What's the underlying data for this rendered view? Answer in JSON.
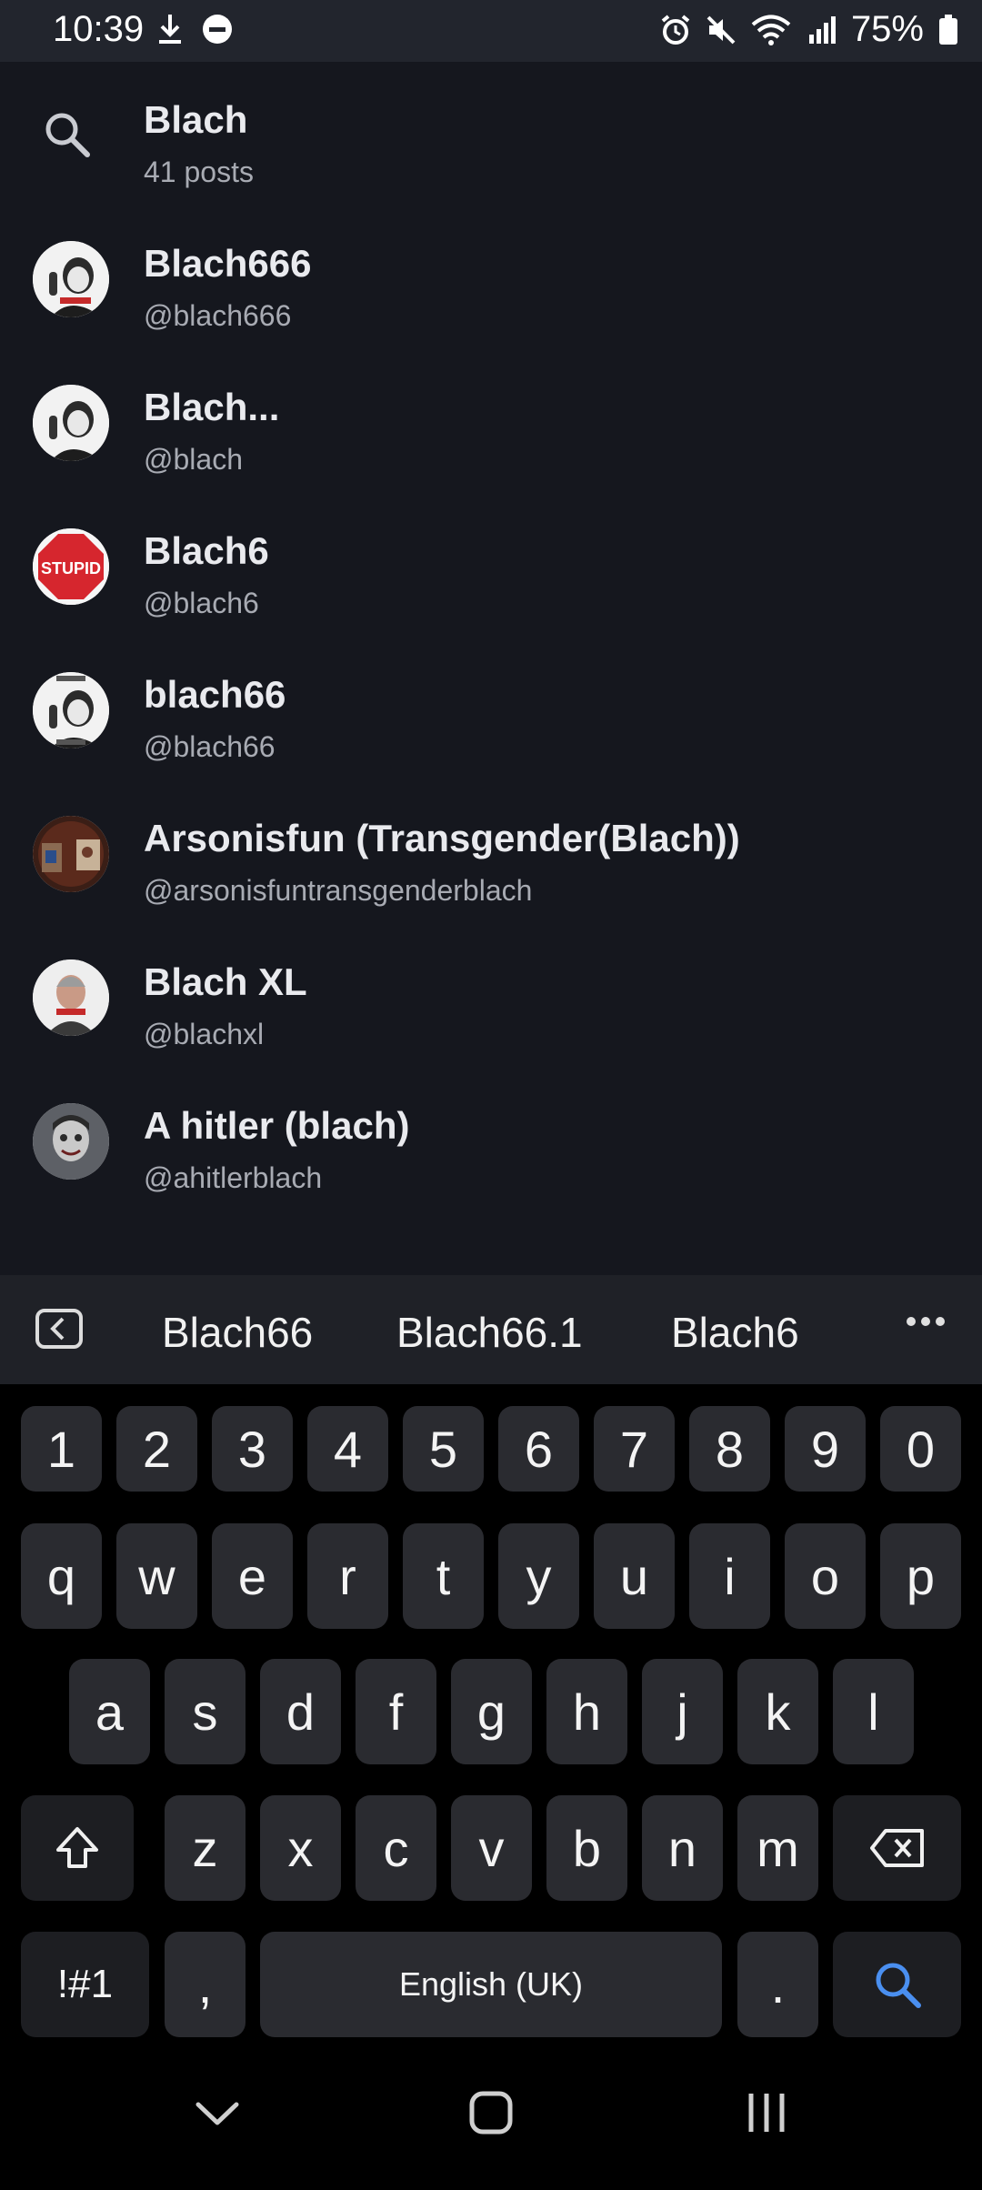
{
  "status_bar": {
    "time": "10:39",
    "battery_percent": "75%",
    "icons": [
      "download-icon",
      "dnd-icon",
      "alarm-icon",
      "mute-icon",
      "wifi-icon",
      "signal-icon",
      "battery-icon"
    ]
  },
  "search_suggestion": {
    "query": "Blach",
    "count_label": "41 posts"
  },
  "users": [
    {
      "name": "Blach666",
      "handle": "@blach666",
      "avatar": "meme-avatar"
    },
    {
      "name": "Blach...",
      "handle": "@blach",
      "avatar": "meme-avatar"
    },
    {
      "name": "Blach6",
      "handle": "@blach6",
      "avatar": "stupid-sign-avatar",
      "avatar_text": "STUPID"
    },
    {
      "name": "blach66",
      "handle": "@blach66",
      "avatar": "meme-avatar"
    },
    {
      "name": "Arsonisfun (Transgender(Blach))",
      "handle": "@arsonisfuntransgenderblach",
      "avatar": "photo-avatar"
    },
    {
      "name": "Blach XL",
      "handle": "@blachxl",
      "avatar": "photo-avatar"
    },
    {
      "name": "A hitler (blach)",
      "handle": "@ahitlerblach",
      "avatar": "photo-avatar"
    }
  ],
  "keyboard": {
    "suggestions": [
      "Blach66",
      "Blach66.1",
      "Blach6"
    ],
    "row_numbers": [
      "1",
      "2",
      "3",
      "4",
      "5",
      "6",
      "7",
      "8",
      "9",
      "0"
    ],
    "row_top": [
      "q",
      "w",
      "e",
      "r",
      "t",
      "y",
      "u",
      "i",
      "o",
      "p"
    ],
    "row_mid": [
      "a",
      "s",
      "d",
      "f",
      "g",
      "h",
      "j",
      "k",
      "l"
    ],
    "row_bottom": [
      "z",
      "x",
      "c",
      "v",
      "b",
      "n",
      "m"
    ],
    "symbols_label": "!#1",
    "comma_label": ",",
    "space_label": "English (UK)",
    "period_label": "."
  },
  "colors": {
    "background": "#15171e",
    "status_bar": "#22252d",
    "key": "#2a2b30",
    "search_key_icon": "#4a8ff0"
  }
}
